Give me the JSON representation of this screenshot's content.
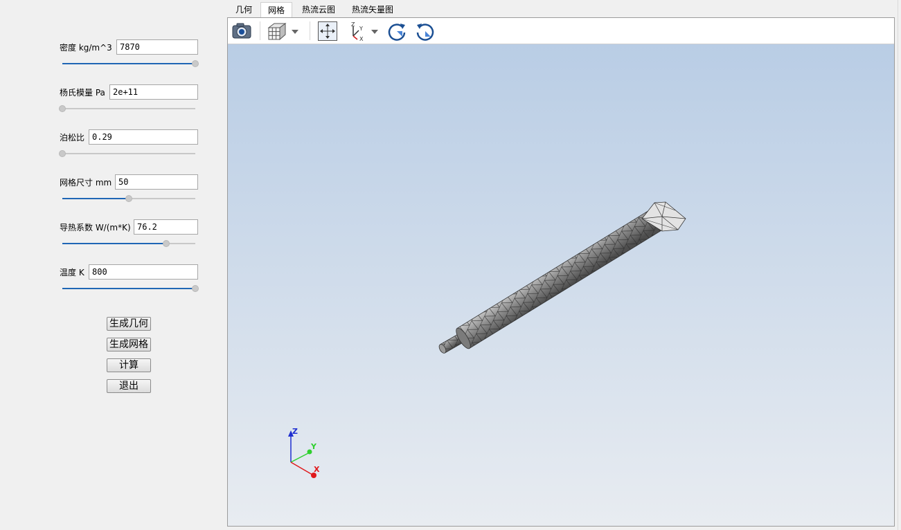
{
  "params": [
    {
      "label": "密度 kg/m^3",
      "value": "7870",
      "slider_fraction": 1.0
    },
    {
      "label": "杨氏模量 Pa",
      "value": "2e+11",
      "slider_fraction": 0.0
    },
    {
      "label": "泊松比",
      "value": "0.29",
      "slider_fraction": 0.0
    },
    {
      "label": "网格尺寸 mm",
      "value": "50",
      "slider_fraction": 0.5
    },
    {
      "label": "导热系数 W/(m*K)",
      "value": "76.2",
      "slider_fraction": 0.78
    },
    {
      "label": "温度 K",
      "value": "800",
      "slider_fraction": 1.0
    }
  ],
  "buttons": {
    "generate_geometry": "生成几何",
    "generate_mesh": "生成网格",
    "compute": "计算",
    "exit": "退出"
  },
  "tabs": [
    {
      "label": "几何",
      "active": false
    },
    {
      "label": "网格",
      "active": true
    },
    {
      "label": "热流云图",
      "active": false
    },
    {
      "label": "热流矢量图",
      "active": false
    }
  ],
  "toolbar_icons": [
    "camera-icon",
    "view-cube-icon",
    "fit-all-icon",
    "axes-triad-icon",
    "rotate-cw-icon",
    "rotate-ccw-icon"
  ],
  "axes": {
    "x": "X",
    "y": "Y",
    "z": "Z"
  },
  "colors": {
    "slider_fill": "#1f66b5",
    "mesh_dark": "#5c5c5c",
    "mesh_light": "#d6d6d6",
    "axis_x": "#e0191c",
    "axis_y": "#2fd02f",
    "axis_z": "#1f2fd0",
    "background_top": "#b9cde5",
    "background_bottom": "#e8ecf1"
  }
}
